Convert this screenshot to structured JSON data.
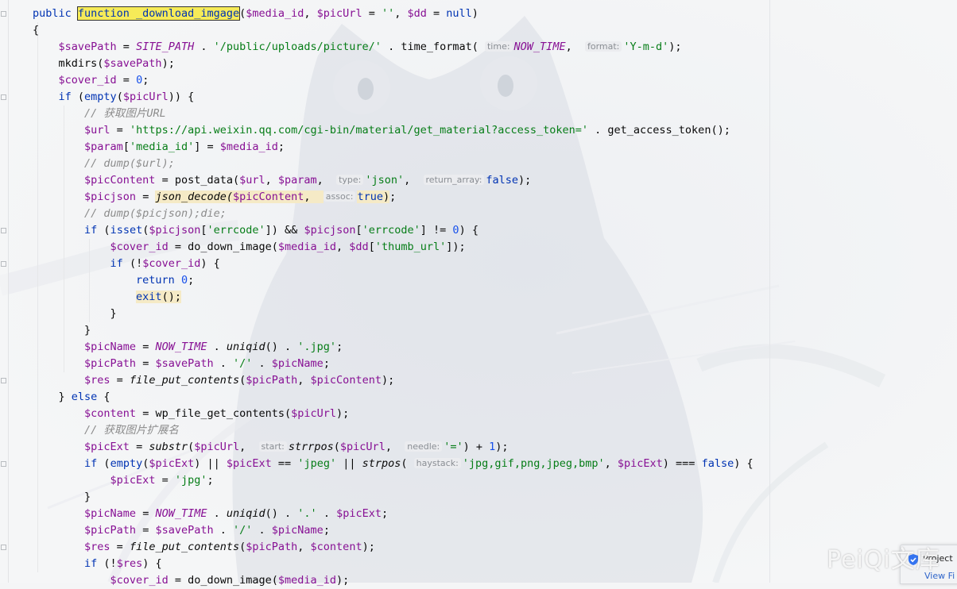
{
  "editor": {
    "search_term": "function _download_imgage",
    "lines": [
      [
        {
          "t": "public ",
          "c": "kw"
        },
        {
          "t": "function _download_imgage",
          "c": "search-hl"
        },
        {
          "t": "("
        },
        {
          "t": "$media_id",
          "c": "var"
        },
        {
          "t": ", "
        },
        {
          "t": "$picUrl",
          "c": "var"
        },
        {
          "t": " = "
        },
        {
          "t": "''",
          "c": "str"
        },
        {
          "t": ", "
        },
        {
          "t": "$dd",
          "c": "var"
        },
        {
          "t": " = "
        },
        {
          "t": "null",
          "c": "kw"
        },
        {
          "t": ")"
        }
      ],
      [
        {
          "t": "{"
        }
      ],
      [
        {
          "t": "    "
        },
        {
          "t": "$savePath",
          "c": "var"
        },
        {
          "t": " = "
        },
        {
          "t": "SITE_PATH",
          "c": "const"
        },
        {
          "t": " . "
        },
        {
          "t": "'/public/uploads/picture/'",
          "c": "str"
        },
        {
          "t": " . time_format( "
        },
        {
          "t": "time:",
          "c": "hint"
        },
        {
          "t": "NOW_TIME",
          "c": "const"
        },
        {
          "t": ",  "
        },
        {
          "t": "format:",
          "c": "hint"
        },
        {
          "t": "'Y-m-d'",
          "c": "str"
        },
        {
          "t": ");"
        }
      ],
      [
        {
          "t": "    mkdirs("
        },
        {
          "t": "$savePath",
          "c": "var"
        },
        {
          "t": ");"
        }
      ],
      [
        {
          "t": "    "
        },
        {
          "t": "$cover_id",
          "c": "var"
        },
        {
          "t": " = "
        },
        {
          "t": "0",
          "c": "num"
        },
        {
          "t": ";"
        }
      ],
      [
        {
          "t": "    "
        },
        {
          "t": "if",
          "c": "kw"
        },
        {
          "t": " ("
        },
        {
          "t": "empty",
          "c": "kw"
        },
        {
          "t": "("
        },
        {
          "t": "$picUrl",
          "c": "var"
        },
        {
          "t": ")) {"
        }
      ],
      [
        {
          "t": "        "
        },
        {
          "t": "// 获取图片URL",
          "c": "cmt"
        }
      ],
      [
        {
          "t": "        "
        },
        {
          "t": "$url",
          "c": "var"
        },
        {
          "t": " = "
        },
        {
          "t": "'https://api.weixin.qq.com/cgi-bin/material/get_material?access_token='",
          "c": "str"
        },
        {
          "t": " . get_access_token();"
        }
      ],
      [
        {
          "t": "        "
        },
        {
          "t": "$param",
          "c": "var"
        },
        {
          "t": "["
        },
        {
          "t": "'media_id'",
          "c": "str"
        },
        {
          "t": "] = "
        },
        {
          "t": "$media_id",
          "c": "var"
        },
        {
          "t": ";"
        }
      ],
      [
        {
          "t": "        "
        },
        {
          "t": "// dump($url);",
          "c": "cmt"
        }
      ],
      [
        {
          "t": "        "
        },
        {
          "t": "$picContent",
          "c": "var"
        },
        {
          "t": " = post_data("
        },
        {
          "t": "$url",
          "c": "var"
        },
        {
          "t": ", "
        },
        {
          "t": "$param",
          "c": "var"
        },
        {
          "t": ",  "
        },
        {
          "t": "type:",
          "c": "hint"
        },
        {
          "t": "'json'",
          "c": "str"
        },
        {
          "t": ",  "
        },
        {
          "t": "return_array:",
          "c": "hint"
        },
        {
          "t": "false",
          "c": "kw"
        },
        {
          "t": ");"
        }
      ],
      [
        {
          "t": "        "
        },
        {
          "t": "$picjson",
          "c": "var"
        },
        {
          "t": " = "
        },
        {
          "t": "json_decode(",
          "c": "warn-it"
        },
        {
          "t": "$picContent",
          "c": "warn-var"
        },
        {
          "t": ",  ",
          "c": "warn-hl"
        },
        {
          "t": "assoc:",
          "c": "hint"
        },
        {
          "t": "true",
          "c": "warn-kw"
        },
        {
          "t": ")",
          "c": "warn-hl"
        },
        {
          "t": ";"
        }
      ],
      [
        {
          "t": "        "
        },
        {
          "t": "// dump($picjson);die;",
          "c": "cmt"
        }
      ],
      [
        {
          "t": "        "
        },
        {
          "t": "if",
          "c": "kw"
        },
        {
          "t": " ("
        },
        {
          "t": "isset",
          "c": "kw"
        },
        {
          "t": "("
        },
        {
          "t": "$picjson",
          "c": "var"
        },
        {
          "t": "["
        },
        {
          "t": "'errcode'",
          "c": "str"
        },
        {
          "t": "]) && "
        },
        {
          "t": "$picjson",
          "c": "var"
        },
        {
          "t": "["
        },
        {
          "t": "'errcode'",
          "c": "str"
        },
        {
          "t": "] != "
        },
        {
          "t": "0",
          "c": "num"
        },
        {
          "t": ") {"
        }
      ],
      [
        {
          "t": "            "
        },
        {
          "t": "$cover_id",
          "c": "var"
        },
        {
          "t": " = do_down_image("
        },
        {
          "t": "$media_id",
          "c": "var"
        },
        {
          "t": ", "
        },
        {
          "t": "$dd",
          "c": "var"
        },
        {
          "t": "["
        },
        {
          "t": "'thumb_url'",
          "c": "str"
        },
        {
          "t": "]);"
        }
      ],
      [
        {
          "t": "            "
        },
        {
          "t": "if",
          "c": "kw"
        },
        {
          "t": " (!"
        },
        {
          "t": "$cover_id",
          "c": "var"
        },
        {
          "t": ") {"
        }
      ],
      [
        {
          "t": "                "
        },
        {
          "t": "return",
          "c": "kw"
        },
        {
          "t": " "
        },
        {
          "t": "0",
          "c": "num"
        },
        {
          "t": ";"
        }
      ],
      [
        {
          "t": "                "
        },
        {
          "t": "exit",
          "c": "warn-kw"
        },
        {
          "t": "();",
          "c": "warn-hl"
        }
      ],
      [
        {
          "t": "            }"
        }
      ],
      [
        {
          "t": "        }"
        }
      ],
      [
        {
          "t": "        "
        },
        {
          "t": "$picName",
          "c": "var"
        },
        {
          "t": " = "
        },
        {
          "t": "NOW_TIME",
          "c": "const"
        },
        {
          "t": " . "
        },
        {
          "t": "uniqid",
          "c": "fn-it"
        },
        {
          "t": "() . "
        },
        {
          "t": "'.jpg'",
          "c": "str"
        },
        {
          "t": ";"
        }
      ],
      [
        {
          "t": "        "
        },
        {
          "t": "$picPath",
          "c": "var"
        },
        {
          "t": " = "
        },
        {
          "t": "$savePath",
          "c": "var"
        },
        {
          "t": " . "
        },
        {
          "t": "'/'",
          "c": "str"
        },
        {
          "t": " . "
        },
        {
          "t": "$picName",
          "c": "var"
        },
        {
          "t": ";"
        }
      ],
      [
        {
          "t": "        "
        },
        {
          "t": "$res",
          "c": "var"
        },
        {
          "t": " = "
        },
        {
          "t": "file_put_contents",
          "c": "fn-it"
        },
        {
          "t": "("
        },
        {
          "t": "$picPath",
          "c": "var"
        },
        {
          "t": ", "
        },
        {
          "t": "$picContent",
          "c": "var"
        },
        {
          "t": ");"
        }
      ],
      [
        {
          "t": "    } "
        },
        {
          "t": "else",
          "c": "kw"
        },
        {
          "t": " {"
        }
      ],
      [
        {
          "t": "        "
        },
        {
          "t": "$content",
          "c": "var"
        },
        {
          "t": " = wp_file_get_contents("
        },
        {
          "t": "$picUrl",
          "c": "var"
        },
        {
          "t": ");"
        }
      ],
      [
        {
          "t": "        "
        },
        {
          "t": "// 获取图片扩展名",
          "c": "cmt"
        }
      ],
      [
        {
          "t": "        "
        },
        {
          "t": "$picExt",
          "c": "var"
        },
        {
          "t": " = "
        },
        {
          "t": "substr",
          "c": "fn-it"
        },
        {
          "t": "("
        },
        {
          "t": "$picUrl",
          "c": "var"
        },
        {
          "t": ",  "
        },
        {
          "t": "start:",
          "c": "hint"
        },
        {
          "t": "strrpos",
          "c": "fn-it"
        },
        {
          "t": "("
        },
        {
          "t": "$picUrl",
          "c": "var"
        },
        {
          "t": ",  "
        },
        {
          "t": "needle:",
          "c": "hint"
        },
        {
          "t": "'='",
          "c": "str"
        },
        {
          "t": ") + "
        },
        {
          "t": "1",
          "c": "num"
        },
        {
          "t": ");"
        }
      ],
      [
        {
          "t": "        "
        },
        {
          "t": "if",
          "c": "kw"
        },
        {
          "t": " ("
        },
        {
          "t": "empty",
          "c": "kw"
        },
        {
          "t": "("
        },
        {
          "t": "$picExt",
          "c": "var"
        },
        {
          "t": ") || "
        },
        {
          "t": "$picExt",
          "c": "var"
        },
        {
          "t": " == "
        },
        {
          "t": "'jpeg'",
          "c": "str"
        },
        {
          "t": " || "
        },
        {
          "t": "strpos",
          "c": "fn-it"
        },
        {
          "t": "( "
        },
        {
          "t": "haystack:",
          "c": "hint"
        },
        {
          "t": "'jpg,gif,png,jpeg,bmp'",
          "c": "str"
        },
        {
          "t": ", "
        },
        {
          "t": "$picExt",
          "c": "var"
        },
        {
          "t": ") === "
        },
        {
          "t": "false",
          "c": "kw"
        },
        {
          "t": ") {"
        }
      ],
      [
        {
          "t": "            "
        },
        {
          "t": "$picExt",
          "c": "var"
        },
        {
          "t": " = "
        },
        {
          "t": "'jpg'",
          "c": "str"
        },
        {
          "t": ";"
        }
      ],
      [
        {
          "t": "        }"
        }
      ],
      [
        {
          "t": "        "
        },
        {
          "t": "$picName",
          "c": "var"
        },
        {
          "t": " = "
        },
        {
          "t": "NOW_TIME",
          "c": "const"
        },
        {
          "t": " . "
        },
        {
          "t": "uniqid",
          "c": "fn-it"
        },
        {
          "t": "() . "
        },
        {
          "t": "'.'",
          "c": "str"
        },
        {
          "t": " . "
        },
        {
          "t": "$picExt",
          "c": "var"
        },
        {
          "t": ";"
        }
      ],
      [
        {
          "t": "        "
        },
        {
          "t": "$picPath",
          "c": "var"
        },
        {
          "t": " = "
        },
        {
          "t": "$savePath",
          "c": "var"
        },
        {
          "t": " . "
        },
        {
          "t": "'/'",
          "c": "str"
        },
        {
          "t": " . "
        },
        {
          "t": "$picName",
          "c": "var"
        },
        {
          "t": ";"
        }
      ],
      [
        {
          "t": "        "
        },
        {
          "t": "$res",
          "c": "var"
        },
        {
          "t": " = "
        },
        {
          "t": "file_put_contents",
          "c": "fn-it"
        },
        {
          "t": "("
        },
        {
          "t": "$picPath",
          "c": "var"
        },
        {
          "t": ", "
        },
        {
          "t": "$content",
          "c": "var"
        },
        {
          "t": ");"
        }
      ],
      [
        {
          "t": "        "
        },
        {
          "t": "if",
          "c": "kw"
        },
        {
          "t": " (!"
        },
        {
          "t": "$res",
          "c": "var"
        },
        {
          "t": ") {"
        }
      ],
      [
        {
          "t": "            "
        },
        {
          "t": "$cover_id",
          "c": "var"
        },
        {
          "t": " = do_down_image("
        },
        {
          "t": "$media_id",
          "c": "var"
        },
        {
          "t": ");"
        }
      ]
    ]
  },
  "watermark": "PeiQi文库",
  "notification": {
    "title": "Project",
    "link": "View Fi"
  },
  "colors": {
    "keyword": "#0033b3",
    "variable": "#871094",
    "string": "#067d17",
    "number": "#1750eb",
    "comment": "#8c8c8c",
    "search_highlight": "#f6eb58",
    "warning_highlight": "#f5eac6"
  }
}
